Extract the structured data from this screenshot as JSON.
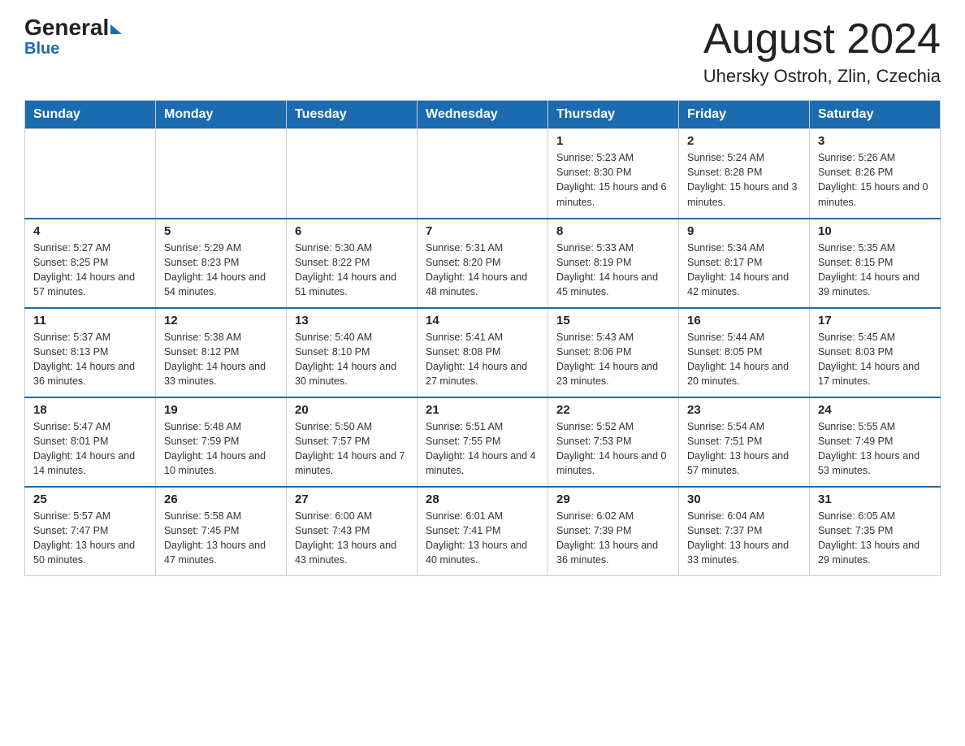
{
  "header": {
    "logo_general": "General",
    "logo_blue": "Blue",
    "month_title": "August 2024",
    "location": "Uhersky Ostroh, Zlin, Czechia"
  },
  "days_of_week": [
    "Sunday",
    "Monday",
    "Tuesday",
    "Wednesday",
    "Thursday",
    "Friday",
    "Saturday"
  ],
  "weeks": [
    {
      "days": [
        {
          "number": "",
          "info": ""
        },
        {
          "number": "",
          "info": ""
        },
        {
          "number": "",
          "info": ""
        },
        {
          "number": "",
          "info": ""
        },
        {
          "number": "1",
          "info": "Sunrise: 5:23 AM\nSunset: 8:30 PM\nDaylight: 15 hours and 6 minutes."
        },
        {
          "number": "2",
          "info": "Sunrise: 5:24 AM\nSunset: 8:28 PM\nDaylight: 15 hours and 3 minutes."
        },
        {
          "number": "3",
          "info": "Sunrise: 5:26 AM\nSunset: 8:26 PM\nDaylight: 15 hours and 0 minutes."
        }
      ]
    },
    {
      "days": [
        {
          "number": "4",
          "info": "Sunrise: 5:27 AM\nSunset: 8:25 PM\nDaylight: 14 hours and 57 minutes."
        },
        {
          "number": "5",
          "info": "Sunrise: 5:29 AM\nSunset: 8:23 PM\nDaylight: 14 hours and 54 minutes."
        },
        {
          "number": "6",
          "info": "Sunrise: 5:30 AM\nSunset: 8:22 PM\nDaylight: 14 hours and 51 minutes."
        },
        {
          "number": "7",
          "info": "Sunrise: 5:31 AM\nSunset: 8:20 PM\nDaylight: 14 hours and 48 minutes."
        },
        {
          "number": "8",
          "info": "Sunrise: 5:33 AM\nSunset: 8:19 PM\nDaylight: 14 hours and 45 minutes."
        },
        {
          "number": "9",
          "info": "Sunrise: 5:34 AM\nSunset: 8:17 PM\nDaylight: 14 hours and 42 minutes."
        },
        {
          "number": "10",
          "info": "Sunrise: 5:35 AM\nSunset: 8:15 PM\nDaylight: 14 hours and 39 minutes."
        }
      ]
    },
    {
      "days": [
        {
          "number": "11",
          "info": "Sunrise: 5:37 AM\nSunset: 8:13 PM\nDaylight: 14 hours and 36 minutes."
        },
        {
          "number": "12",
          "info": "Sunrise: 5:38 AM\nSunset: 8:12 PM\nDaylight: 14 hours and 33 minutes."
        },
        {
          "number": "13",
          "info": "Sunrise: 5:40 AM\nSunset: 8:10 PM\nDaylight: 14 hours and 30 minutes."
        },
        {
          "number": "14",
          "info": "Sunrise: 5:41 AM\nSunset: 8:08 PM\nDaylight: 14 hours and 27 minutes."
        },
        {
          "number": "15",
          "info": "Sunrise: 5:43 AM\nSunset: 8:06 PM\nDaylight: 14 hours and 23 minutes."
        },
        {
          "number": "16",
          "info": "Sunrise: 5:44 AM\nSunset: 8:05 PM\nDaylight: 14 hours and 20 minutes."
        },
        {
          "number": "17",
          "info": "Sunrise: 5:45 AM\nSunset: 8:03 PM\nDaylight: 14 hours and 17 minutes."
        }
      ]
    },
    {
      "days": [
        {
          "number": "18",
          "info": "Sunrise: 5:47 AM\nSunset: 8:01 PM\nDaylight: 14 hours and 14 minutes."
        },
        {
          "number": "19",
          "info": "Sunrise: 5:48 AM\nSunset: 7:59 PM\nDaylight: 14 hours and 10 minutes."
        },
        {
          "number": "20",
          "info": "Sunrise: 5:50 AM\nSunset: 7:57 PM\nDaylight: 14 hours and 7 minutes."
        },
        {
          "number": "21",
          "info": "Sunrise: 5:51 AM\nSunset: 7:55 PM\nDaylight: 14 hours and 4 minutes."
        },
        {
          "number": "22",
          "info": "Sunrise: 5:52 AM\nSunset: 7:53 PM\nDaylight: 14 hours and 0 minutes."
        },
        {
          "number": "23",
          "info": "Sunrise: 5:54 AM\nSunset: 7:51 PM\nDaylight: 13 hours and 57 minutes."
        },
        {
          "number": "24",
          "info": "Sunrise: 5:55 AM\nSunset: 7:49 PM\nDaylight: 13 hours and 53 minutes."
        }
      ]
    },
    {
      "days": [
        {
          "number": "25",
          "info": "Sunrise: 5:57 AM\nSunset: 7:47 PM\nDaylight: 13 hours and 50 minutes."
        },
        {
          "number": "26",
          "info": "Sunrise: 5:58 AM\nSunset: 7:45 PM\nDaylight: 13 hours and 47 minutes."
        },
        {
          "number": "27",
          "info": "Sunrise: 6:00 AM\nSunset: 7:43 PM\nDaylight: 13 hours and 43 minutes."
        },
        {
          "number": "28",
          "info": "Sunrise: 6:01 AM\nSunset: 7:41 PM\nDaylight: 13 hours and 40 minutes."
        },
        {
          "number": "29",
          "info": "Sunrise: 6:02 AM\nSunset: 7:39 PM\nDaylight: 13 hours and 36 minutes."
        },
        {
          "number": "30",
          "info": "Sunrise: 6:04 AM\nSunset: 7:37 PM\nDaylight: 13 hours and 33 minutes."
        },
        {
          "number": "31",
          "info": "Sunrise: 6:05 AM\nSunset: 7:35 PM\nDaylight: 13 hours and 29 minutes."
        }
      ]
    }
  ]
}
